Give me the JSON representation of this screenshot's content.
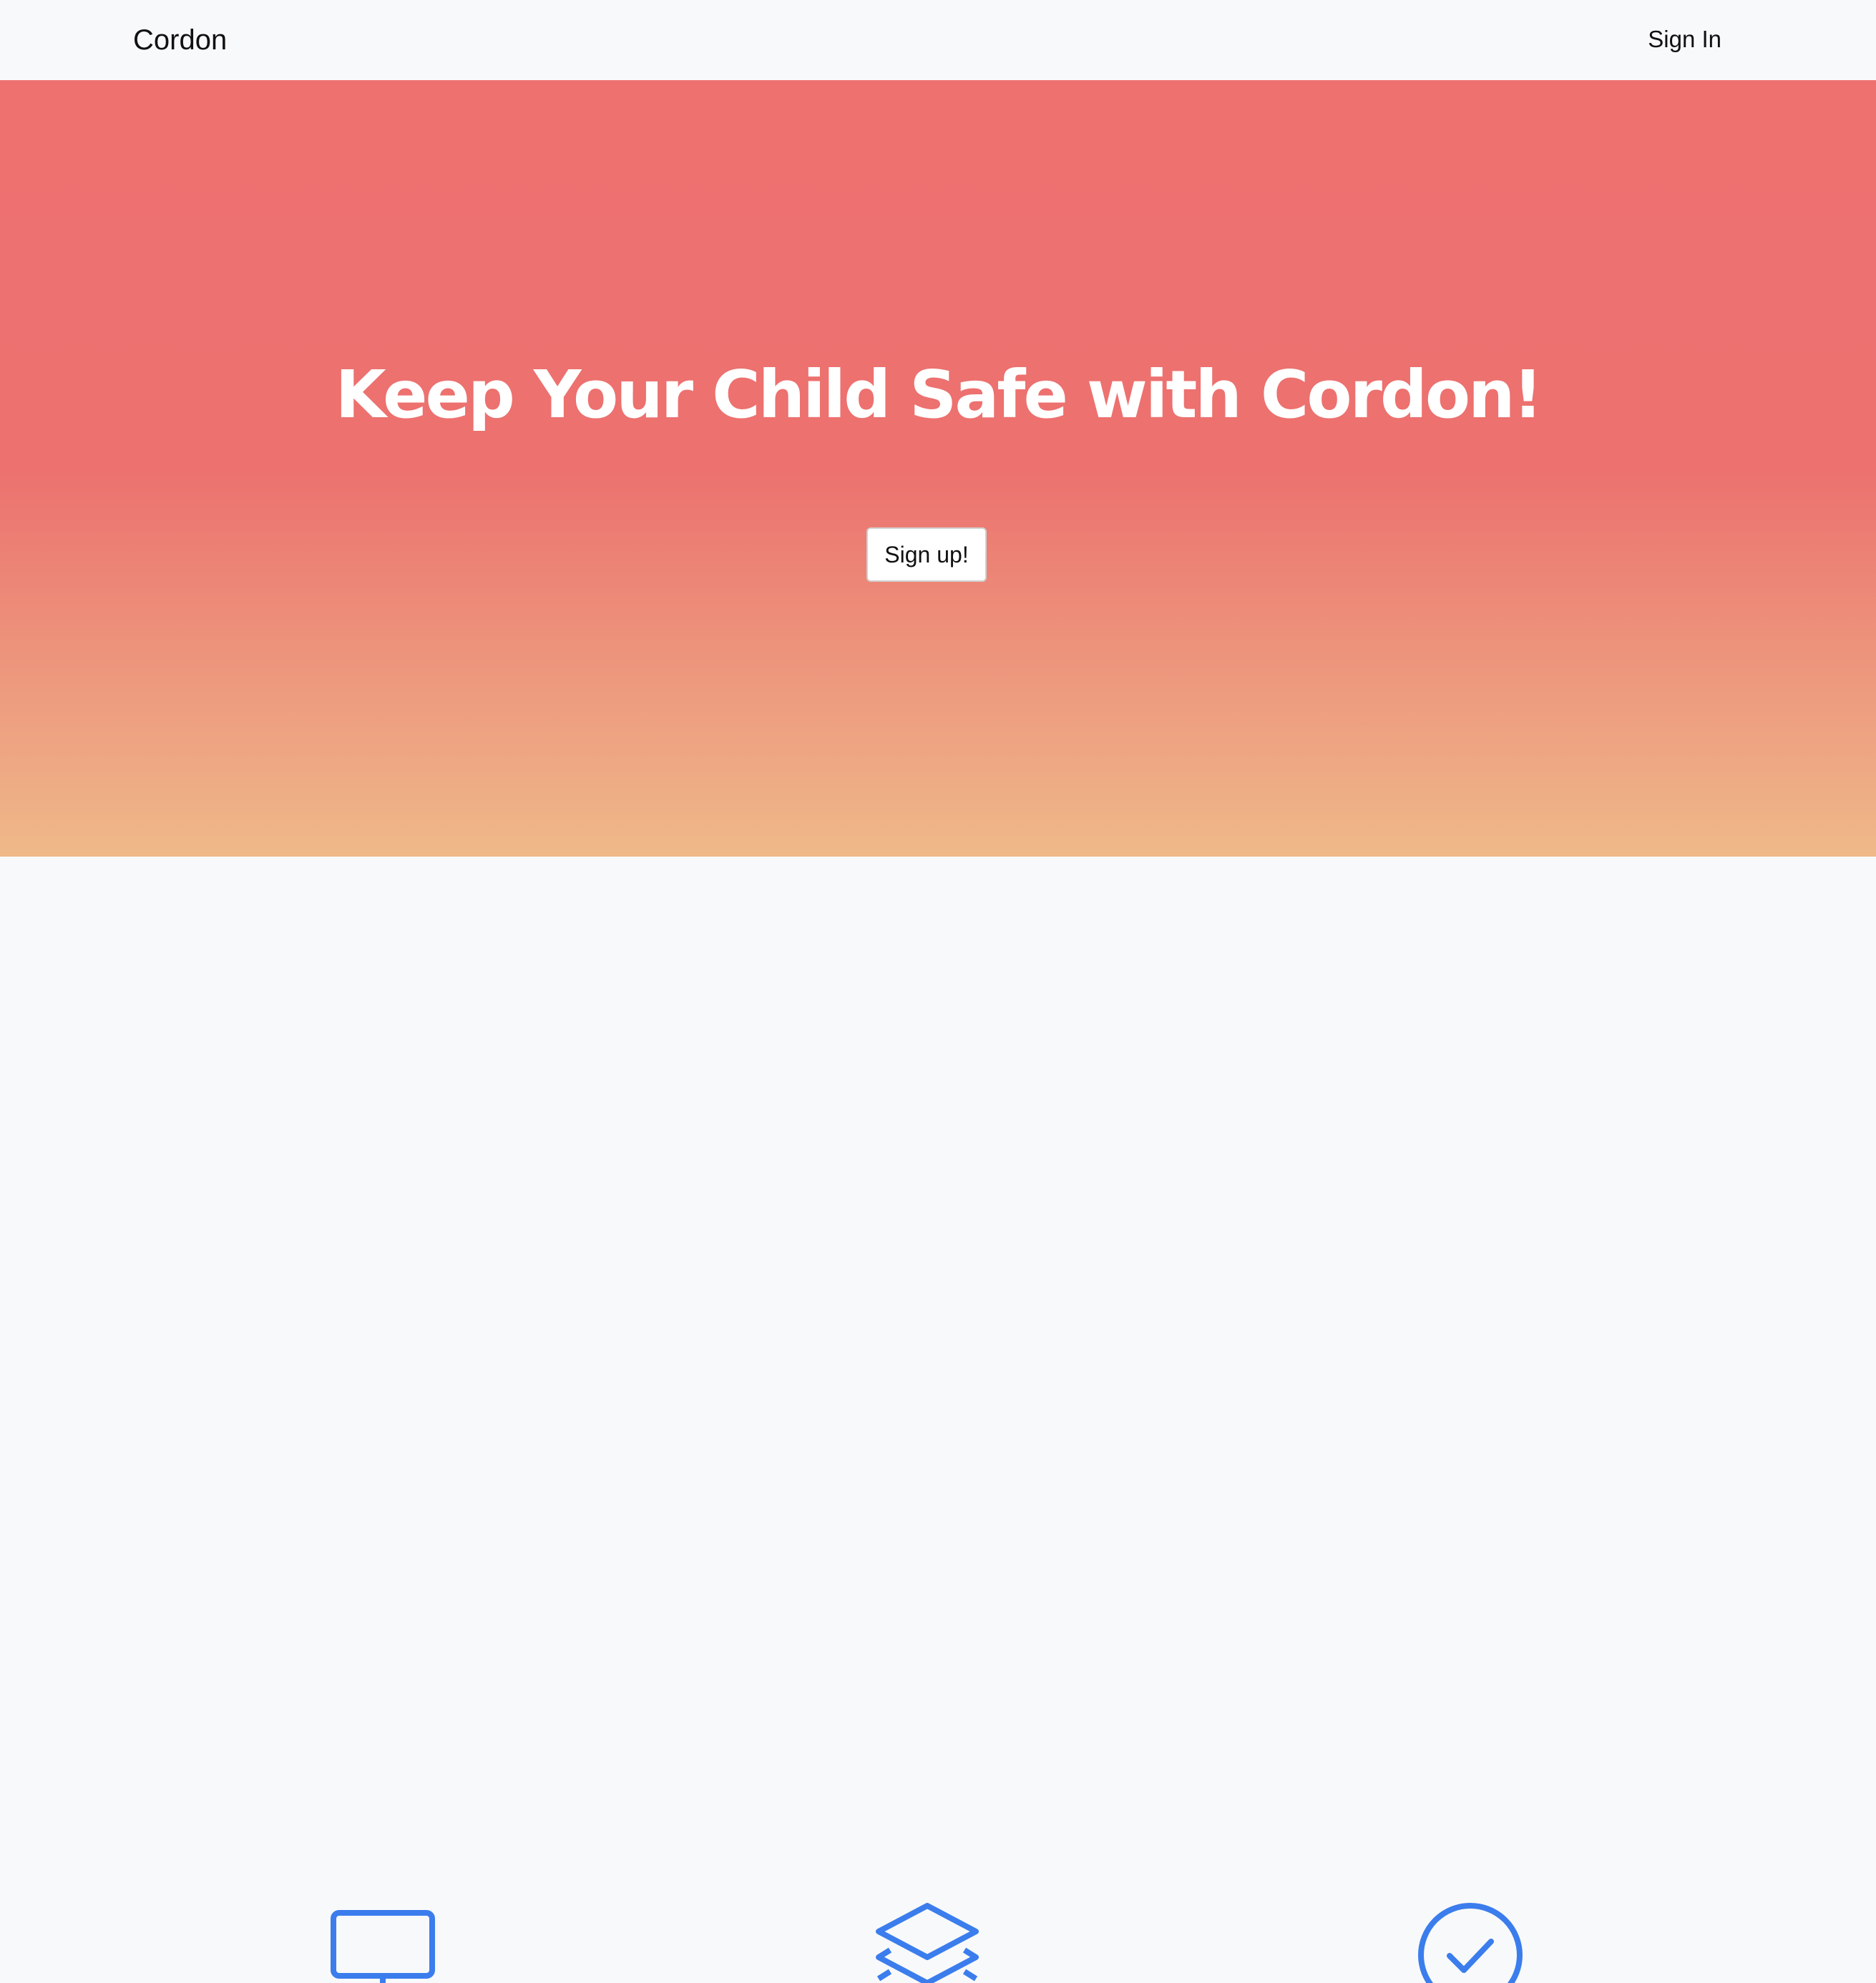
{
  "navbar": {
    "brand": "Cordon",
    "sign_in_label": "Sign In"
  },
  "hero": {
    "title": "Keep Your Child Safe with Cordon!",
    "signup_label": "Sign up!"
  },
  "features": {
    "icons": [
      "monitor-icon",
      "layers-icon",
      "check-circle-icon"
    ],
    "icon_color": "#3b7ded"
  },
  "colors": {
    "hero_top": "#ee7170",
    "hero_bottom": "#efb989",
    "page_bg": "#f8f9fa"
  }
}
